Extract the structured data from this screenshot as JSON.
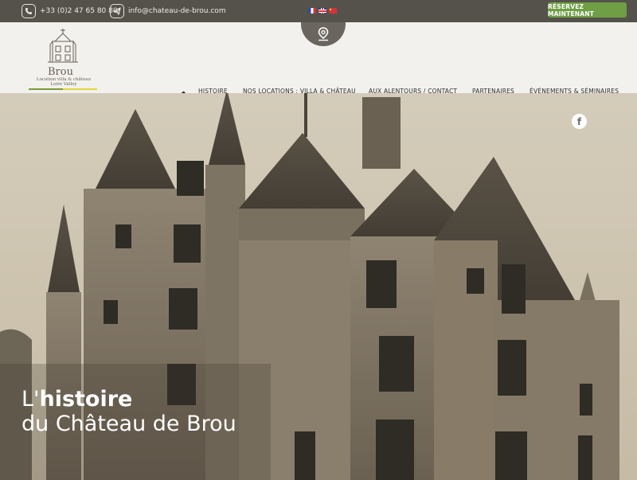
{
  "topbar": {
    "phone": "+33 (0)2 47 65 80 80",
    "email": "info@chateau-de-brou.com",
    "reserve_label": "RÉSERVEZ MAINTENANT"
  },
  "logo": {
    "name": "Brou",
    "tagline": "Location villa & château",
    "region": "Loire Valley"
  },
  "nav": {
    "items": [
      "HISTOIRE",
      "NOS LOCATIONS : VILLA & CHÂTEAU",
      "AUX ALENTOURS / CONTACT",
      "PARTENAIRES",
      "ÉVÉNEMENTS & SÉMINAIRES"
    ]
  },
  "hero": {
    "title_prefix": "L'",
    "title_bold": "histoire",
    "title_line2": "du Château de Brou"
  },
  "icons": {
    "phone": "phone-icon",
    "email": "paper-plane-icon",
    "map": "map-pin-icon",
    "home": "home-icon",
    "facebook": "facebook-icon"
  },
  "colors": {
    "topbar": "#55524c",
    "reserve": "#6f9e44",
    "header": "#f2f1ed",
    "sepia": "#cfc6b4"
  }
}
